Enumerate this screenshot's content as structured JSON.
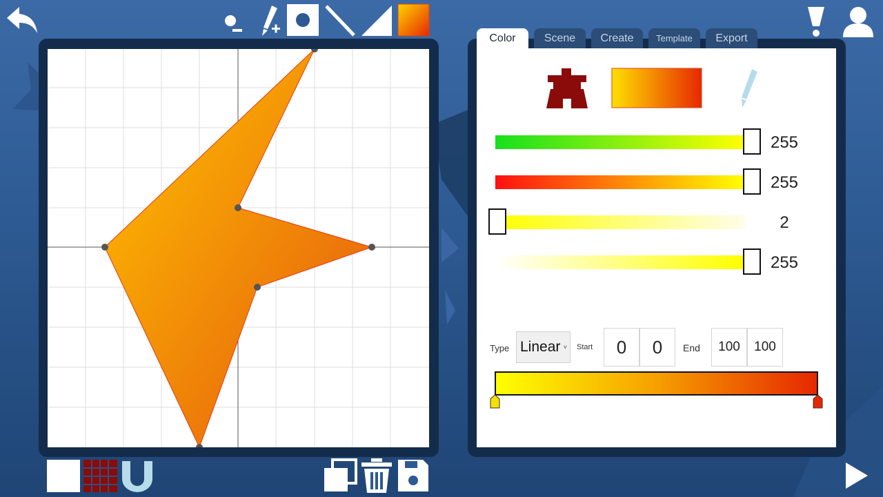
{
  "toolbar": {
    "back_icon": "back-arrow-icon",
    "tools": [
      "remove-point-icon",
      "add-pen-icon",
      "circle-tool-icon",
      "line-tool-icon",
      "triangle-tool-icon",
      "fill-swatch-icon"
    ],
    "alert_icon": "exclamation-icon",
    "profile_icon": "user-icon"
  },
  "tabs": [
    {
      "label": "Color",
      "active": true
    },
    {
      "label": "Scene",
      "active": false
    },
    {
      "label": "Create",
      "active": false
    },
    {
      "label": "Template",
      "active": false
    },
    {
      "label": "Export",
      "active": false
    }
  ],
  "color_panel": {
    "mode_icons": [
      "solid-fill-icon",
      "gradient-swatch-icon",
      "pencil-icon"
    ],
    "sliders": [
      {
        "id": "green",
        "value": "255",
        "level": 1.0
      },
      {
        "id": "red",
        "value": "255",
        "level": 1.0
      },
      {
        "id": "blue",
        "value": "2",
        "level": 0.0
      },
      {
        "id": "alpha",
        "value": "255",
        "level": 1.0
      }
    ],
    "gradient": {
      "type_label": "Type",
      "type_value": "Linear",
      "start_label": "Start",
      "start_x": "0",
      "start_y": "0",
      "end_label": "End",
      "end_x": "100",
      "end_y": "100",
      "start_color": "#ffff00",
      "end_color": "#e62800"
    }
  },
  "bottom_bar": {
    "left_icons": [
      "white-square-icon",
      "grid-icon",
      "magnet-icon"
    ],
    "center_icons": [
      "duplicate-icon",
      "trash-icon",
      "save-icon"
    ],
    "play_icon": "play-icon"
  },
  "colors": {
    "accent": "#3c6aa6",
    "panel_frame": "#142c4c",
    "shape_start": "#ffc400",
    "shape_end": "#e4550e"
  }
}
